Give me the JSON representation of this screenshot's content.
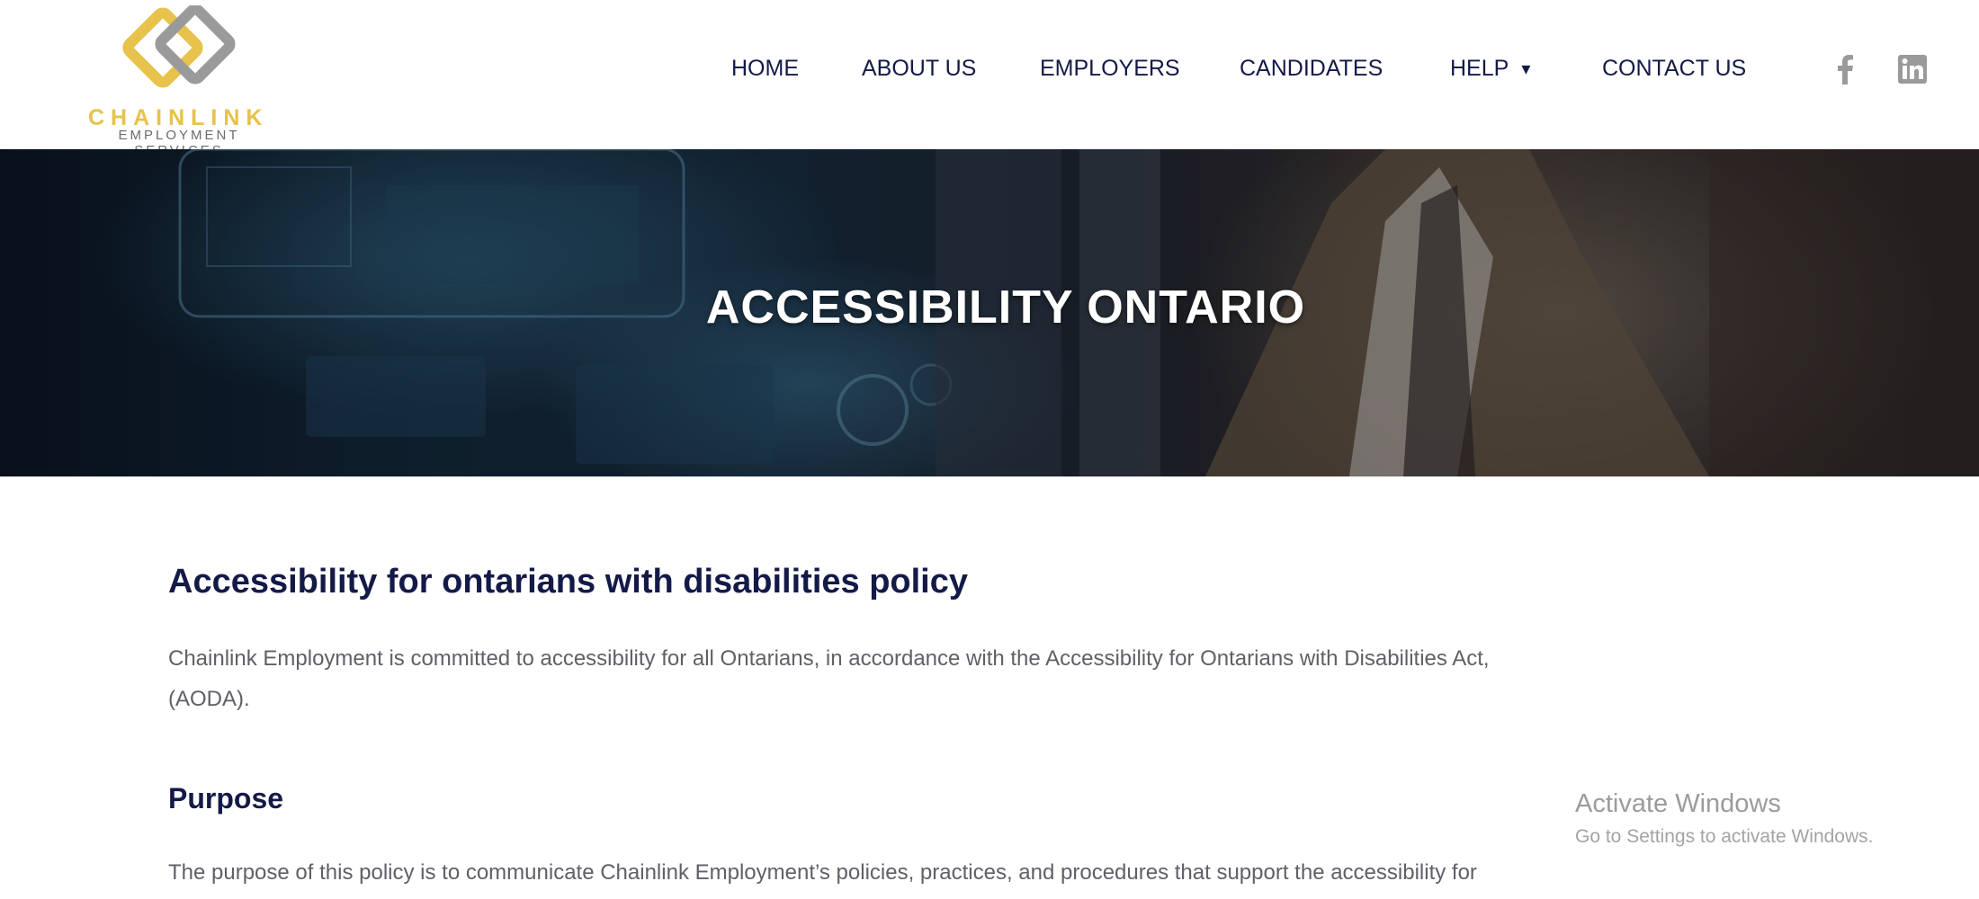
{
  "brand": {
    "name": "CHAINLINK",
    "tagline": "EMPLOYMENT SERVICES",
    "colors": {
      "gold": "#e7c24c",
      "gray": "#9a9a9a",
      "navy": "#141a48"
    }
  },
  "nav": {
    "items": [
      {
        "label": "HOME"
      },
      {
        "label": "ABOUT US"
      },
      {
        "label": "EMPLOYERS"
      },
      {
        "label": "CANDIDATES"
      },
      {
        "label": "HELP",
        "has_dropdown": true,
        "icon": "chevron-down-icon"
      },
      {
        "label": "CONTACT US"
      }
    ]
  },
  "social": [
    {
      "icon": "facebook-icon"
    },
    {
      "icon": "linkedin-icon"
    }
  ],
  "hero": {
    "title": "ACCESSIBILITY ONTARIO"
  },
  "content": {
    "heading": "Accessibility for ontarians with disabilities policy",
    "intro_line1": "Chainlink Employment is committed to accessibility for all Ontarians, in accordance with the Accessibility for Ontarians with Disabilities Act,",
    "intro_line2": "(AODA).",
    "purpose_heading": "Purpose",
    "purpose_text": "The purpose of this policy is to communicate Chainlink Employment’s policies, practices, and procedures that support the accessibility for"
  },
  "os_watermark": {
    "title": "Activate Windows",
    "subtitle": "Go to Settings to activate Windows."
  }
}
